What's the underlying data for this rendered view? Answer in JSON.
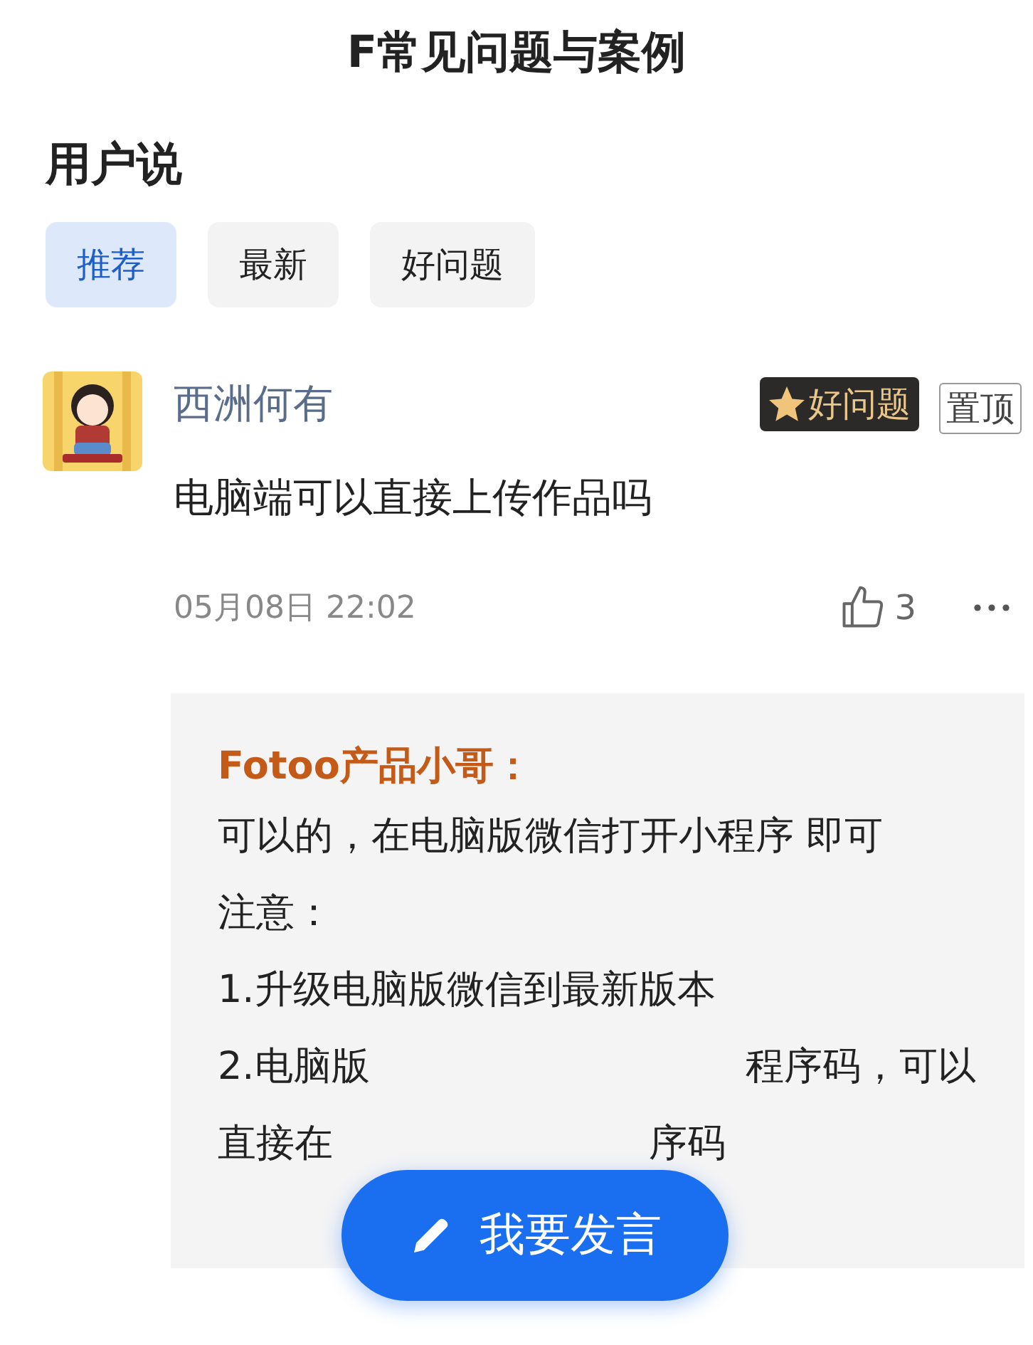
{
  "header": {
    "title": "F常见问题与案例"
  },
  "section": {
    "title": "用户说"
  },
  "tabs": [
    {
      "label": "推荐",
      "selected": true
    },
    {
      "label": "最新",
      "selected": false
    },
    {
      "label": "好问题",
      "selected": false
    }
  ],
  "post": {
    "author": "西洲何有",
    "badge": "好问题",
    "pin": "置顶",
    "question": "电脑端可以直接上传作品吗",
    "time": "05月08日 22:02",
    "likes": "3",
    "reply": {
      "author": "Fotoo产品小哥：",
      "lines": [
        {
          "kind": "text",
          "text": "可以的，在电脑版微信打开小程序 即可"
        },
        {
          "kind": "text",
          "text": "注意："
        },
        {
          "kind": "text",
          "text": "1.升级电脑版微信到最新版本"
        },
        {
          "kind": "covered",
          "left": "2.电脑版",
          "right": "程序码，可以"
        },
        {
          "kind": "covered",
          "left": "直接在",
          "right": "序码"
        }
      ]
    }
  },
  "fab": {
    "label": "我要发言"
  }
}
